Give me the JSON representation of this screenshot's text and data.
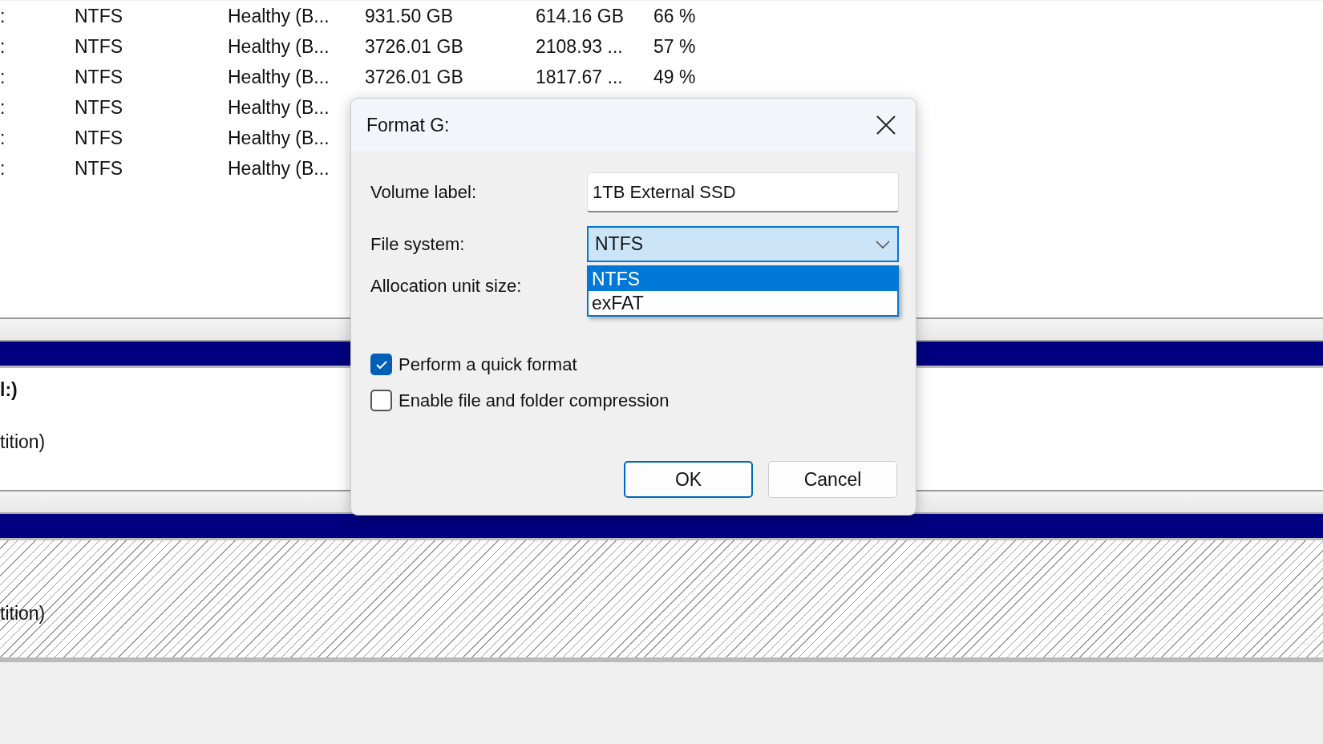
{
  "volume_table": {
    "rows": [
      {
        "cells": [
          ":",
          "NTFS",
          "Healthy (B...",
          "931.50 GB",
          "614.16 GB",
          "66 %"
        ]
      },
      {
        "cells": [
          ":",
          "NTFS",
          "Healthy (B...",
          "3726.01 GB",
          "2108.93 ...",
          "57 %"
        ]
      },
      {
        "cells": [
          ":",
          "NTFS",
          "Healthy (B...",
          "3726.01 GB",
          "1817.67 ...",
          "49 %"
        ]
      },
      {
        "cells": [
          ":",
          "NTFS",
          "Healthy (B..."
        ]
      },
      {
        "cells": [
          ":",
          "NTFS",
          "Healthy (B..."
        ]
      },
      {
        "cells": [
          ":",
          "NTFS",
          "Healthy (B..."
        ]
      }
    ]
  },
  "disk_map": [
    {
      "kind": "plain",
      "title": "l:)",
      "detail": "tition)"
    },
    {
      "kind": "hatched",
      "detail": "tition)"
    }
  ],
  "dialog": {
    "title": "Format G:",
    "volume_label": {
      "label": "Volume label:",
      "value": "1TB External SSD"
    },
    "file_system": {
      "label": "File system:",
      "value": "NTFS",
      "expanded": true,
      "options": [
        {
          "label": "NTFS",
          "selected": true
        },
        {
          "label": "exFAT",
          "selected": false
        }
      ]
    },
    "allocation_unit_size": {
      "label": "Allocation unit size:"
    },
    "checkboxes": [
      {
        "label": "Perform a quick format",
        "checked": true
      },
      {
        "label": "Enable file and folder compression",
        "checked": false
      }
    ],
    "buttons": [
      {
        "label": "OK",
        "default": true
      },
      {
        "label": "Cancel",
        "default": false
      }
    ]
  }
}
